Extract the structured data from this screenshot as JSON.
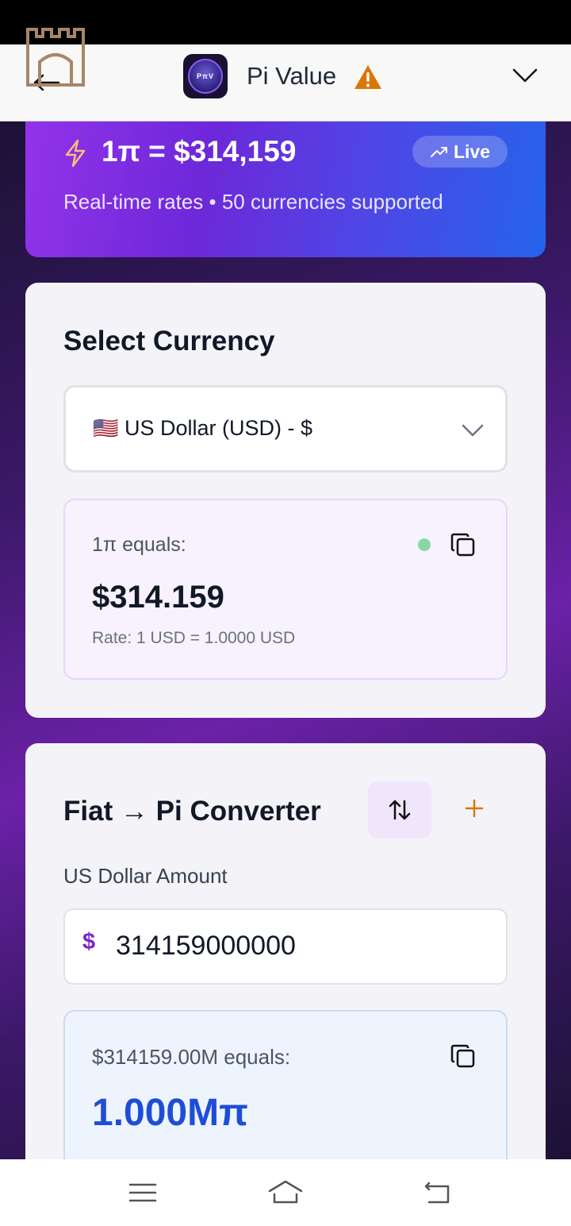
{
  "header": {
    "title": "Pi Value",
    "logo_text": "PπV",
    "icons": [
      "castle-icon",
      "back-arrow-icon",
      "warning-icon",
      "chevron-down-icon"
    ]
  },
  "hero": {
    "rate": "1π = $314,159",
    "live_label": "Live",
    "subtitle": "Real-time rates • 50 currencies supported",
    "icons": [
      "lightning-icon",
      "trending-up-icon"
    ]
  },
  "currency_card": {
    "title": "Select Currency",
    "select": {
      "flag": "🇺🇸",
      "selected_value": "US Dollar (USD) - $"
    },
    "result": {
      "label": "1π equals:",
      "value": "$314.159",
      "rate": "Rate: 1 USD = 1.0000 USD"
    }
  },
  "converter_card": {
    "title": "Fiat → Pi Converter",
    "amount_label": "US Dollar Amount",
    "currency_symbol": "$",
    "amount_value": "314159000000",
    "result": {
      "label": "$314159.00M equals:",
      "value": "1.000Mπ"
    }
  },
  "colors": {
    "accent_purple": "#7e22ce",
    "accent_blue": "#1d4ed8",
    "warning": "#d97706",
    "live_dot": "#86d9a5"
  },
  "nav": [
    "menu-icon",
    "home-icon",
    "back-icon"
  ]
}
